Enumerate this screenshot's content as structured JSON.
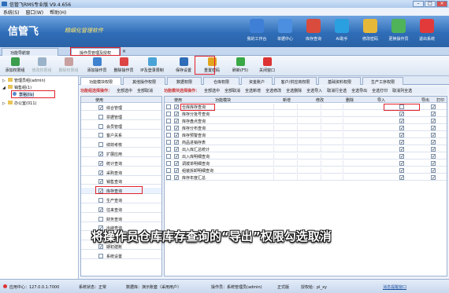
{
  "window": {
    "title": "信管飞RMS专业版 V9.4.656",
    "controls": [
      "–",
      "□",
      "×"
    ]
  },
  "menu": [
    "系统(S)",
    "窗口(W)",
    "帮助(H)"
  ],
  "banner": {
    "logo": "信管飞",
    "subtitle": "精细化管理软件"
  },
  "top_buttons": [
    {
      "label": "我的工作台",
      "icon": "desk-icon",
      "color": "#3f7fd6"
    },
    {
      "label": "单据中心",
      "icon": "document-icon",
      "color": "#4c8fe0"
    },
    {
      "label": "库存查询",
      "icon": "warehouse-icon",
      "color": "#d94b3d"
    },
    {
      "label": "AI助手",
      "icon": "ai-assistant-icon",
      "color": "#2aa0e0"
    },
    {
      "label": "修改密码",
      "icon": "lock-icon",
      "color": "#e6b83a"
    },
    {
      "label": "更换操作员",
      "icon": "users-icon",
      "color": "#4fb35a"
    },
    {
      "label": "退出系统",
      "icon": "exit-icon",
      "color": "#e2393b"
    }
  ],
  "main_tabs": [
    "功能导航窗",
    "操作员管理及授权"
  ],
  "main_tab_close": "×",
  "toolbar": [
    {
      "label": "添加权限组",
      "disabled": false,
      "color": "#3c9d4c"
    },
    {
      "label": "修改权限组",
      "disabled": true,
      "color": "#9bb3c9"
    },
    {
      "label": "删除权限组",
      "disabled": true,
      "color": "#c9a0a0"
    },
    {
      "label": "添加操作员",
      "disabled": false,
      "color": "#3e82d0"
    },
    {
      "label": "删除操作员",
      "disabled": false,
      "color": "#d44"
    },
    {
      "label": "IP及登录限制",
      "disabled": false,
      "color": "#4aa3d6"
    },
    {
      "label": "保存设置",
      "disabled": false,
      "color": "#2f6db8"
    },
    {
      "label": "重置密码",
      "disabled": false,
      "color": "#e3a520"
    },
    {
      "label": "刷新(F5)",
      "disabled": false,
      "color": "#39a845"
    },
    {
      "label": "关闭窗口",
      "disabled": false,
      "color": "#d33"
    }
  ],
  "tree": [
    {
      "label": "管理员组(admin)",
      "level": 1
    },
    {
      "label": "销售组(1)",
      "level": 1
    },
    {
      "label": "李裕(lis)",
      "level": 2
    },
    {
      "label": "办公室(011)",
      "level": 1
    }
  ],
  "sub_tabs": [
    "功能模块权限",
    "其他操作权限",
    "数据权限",
    "仓库权限",
    "资金账户",
    "客户/供应商权限",
    "基础资料权限",
    "生产工序权限"
  ],
  "function_bar": {
    "title": "功能组选择操作：",
    "actions": [
      "全部选中",
      "全部取消"
    ]
  },
  "module_bar": {
    "title": "功能模块选择操作：",
    "actions": [
      "全部选中",
      "全部取消",
      "全选新增",
      "全选修改",
      "全选删除",
      "全选导入",
      "取消行全选",
      "全选导出",
      "全选打印",
      "取消列全选"
    ]
  },
  "left_grid": {
    "header": "使用",
    "items": [
      {
        "label": "综合管理",
        "checked": true
      },
      {
        "label": "票据管理",
        "checked": false
      },
      {
        "label": "会员管理",
        "checked": false
      },
      {
        "label": "客户关系",
        "checked": false
      },
      {
        "label": "绩效考核",
        "checked": false
      },
      {
        "label": "扩展应用",
        "checked": true
      },
      {
        "label": "统计查询",
        "checked": true
      },
      {
        "label": "采购查询",
        "checked": true
      },
      {
        "label": "销售查询",
        "checked": true
      },
      {
        "label": "库存查询",
        "checked": true
      },
      {
        "label": "生产查询",
        "checked": false
      },
      {
        "label": "往来查询",
        "checked": true
      },
      {
        "label": "财务查询",
        "checked": false
      },
      {
        "label": "出纳查询",
        "checked": true
      },
      {
        "label": "基础资料",
        "checked": true
      },
      {
        "label": "期初建账",
        "checked": true
      },
      {
        "label": "系统设置",
        "checked": false
      }
    ]
  },
  "right_grid": {
    "headers": [
      "使用",
      "功能模块",
      "新增",
      "修改",
      "删除",
      "导入",
      "导出",
      "打印"
    ],
    "rows": [
      {
        "name": "仓库库存查询",
        "use": true,
        "export": false,
        "print": true
      },
      {
        "name": "库存分批号查询",
        "use": true,
        "export": true,
        "print": true
      },
      {
        "name": "库存盘点查询",
        "use": true,
        "export": true,
        "print": true
      },
      {
        "name": "库存分布查询",
        "use": true,
        "export": true,
        "print": true
      },
      {
        "name": "库存预警查询",
        "use": true,
        "export": true,
        "print": true
      },
      {
        "name": "商品进销存表",
        "use": true,
        "export": true,
        "print": true
      },
      {
        "name": "出入库汇总统计",
        "use": true,
        "export": true,
        "print": true
      },
      {
        "name": "出入库明细查询",
        "use": true,
        "export": true,
        "print": true
      },
      {
        "name": "调拨单明细查询",
        "use": true,
        "export": true,
        "print": true
      },
      {
        "name": "组装拆卸明细查询",
        "use": true,
        "export": true,
        "print": true
      },
      {
        "name": "库存年度汇总",
        "use": true,
        "export": true,
        "print": true
      }
    ]
  },
  "annotation": "将操作员仓库库存查询的“导出”权限勾选取消",
  "status": [
    "应用中心：127.0.0.1:7000",
    "系统状态：正常",
    "数据库：演示账套（采用用户）",
    "操作员：系统管理员(admin)",
    "正式版",
    "授权给：pl_xy",
    "消息提醒窗口"
  ],
  "colors": {
    "banner": "#2f6db8",
    "highlight": "#e0202a",
    "accent_yellow": "#ffe86b"
  }
}
